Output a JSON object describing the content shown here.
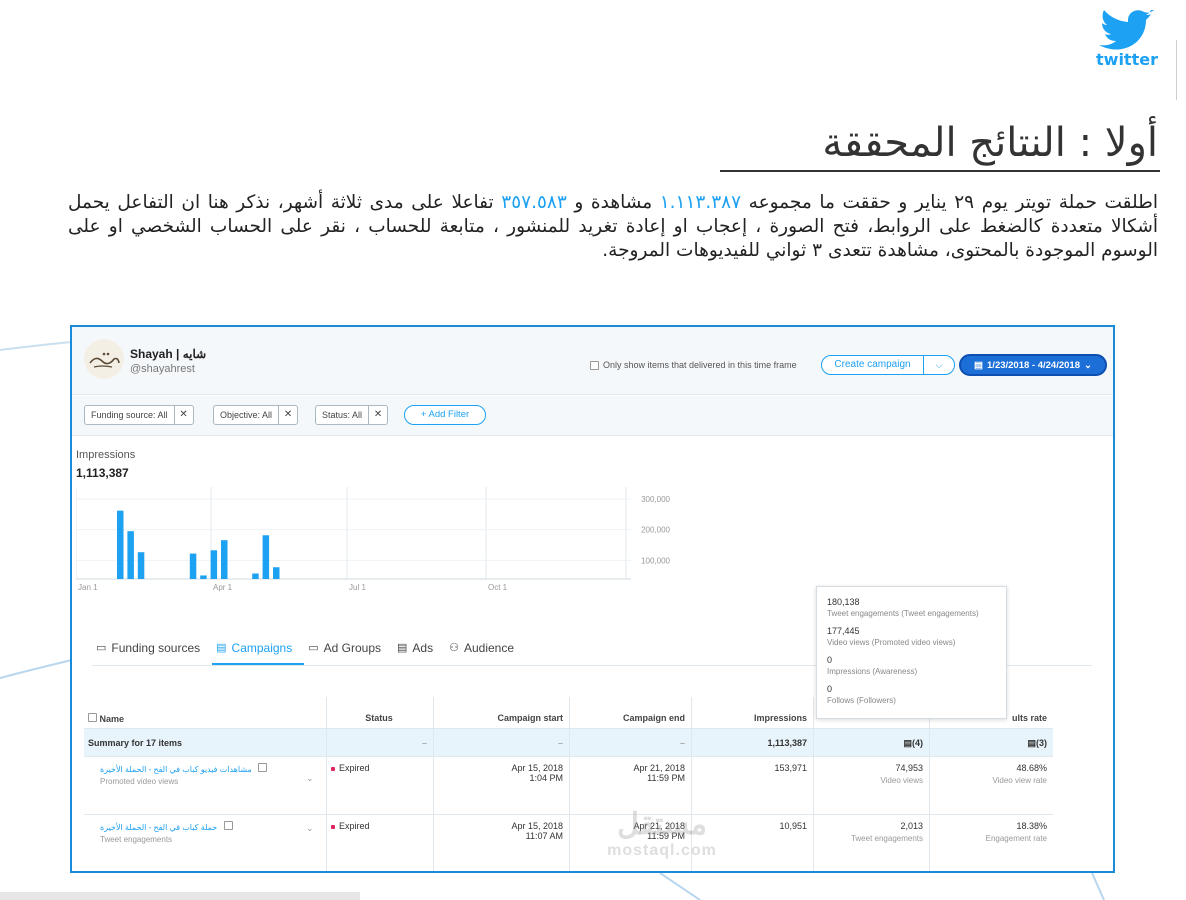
{
  "brand": {
    "logo_word": "twitter"
  },
  "heading": "أولا : النتائج المحققة",
  "paragraph": {
    "part1": "اطلقت حملة تويتر يوم ٢٩ يناير و حققت ما مجموعه ",
    "views_num": "١.١١٣.٣٨٧",
    "part2": " مشاهدة و ",
    "engage_num": "٣٥٧.٥٨٣",
    "part3": " تفاعلا على مدى ثلاثة أشهر، نذكر هنا ان التفاعل يحمل أشكالا متعددة كالضغط على الروابط، فتح الصورة ، إعجاب او إعادة تغريد للمنشور ، متابعة للحساب ، نقر على الحساب الشخصي او على الوسوم الموجودة بالمحتوى، مشاهدة تتعدى ٣ ثواني للفيديوهات المروجة."
  },
  "account": {
    "name": "Shayah | شايه",
    "handle": "@shayahrest"
  },
  "toolbar": {
    "only_show": "Only show items that delivered in this time frame",
    "create_campaign": "Create campaign",
    "date_range": "1/23/2018 - 4/24/2018"
  },
  "filters": [
    {
      "label": "Funding source: All"
    },
    {
      "label": "Objective: All"
    },
    {
      "label": "Status: All"
    }
  ],
  "add_filter": "+ Add Filter",
  "metric": {
    "label": "Impressions",
    "value": "1,113,387"
  },
  "chart_data": {
    "type": "bar",
    "ylabel": "",
    "yticks": [
      "100,000",
      "200,000",
      "300,000"
    ],
    "ylim": [
      0,
      300000
    ],
    "xticks": [
      "Jan 1",
      "Apr 1",
      "Jul 1",
      "Oct 1"
    ],
    "series": [
      {
        "values": [
          250000,
          175000,
          98000,
          0,
          0,
          0,
          0,
          93000,
          13000,
          105000,
          142000,
          0,
          0,
          20000,
          160000,
          43000
        ]
      }
    ],
    "color": "#1da1f2",
    "grid": true
  },
  "tabs": [
    {
      "label": "Funding sources",
      "icon": "card-icon"
    },
    {
      "label": "Campaigns",
      "icon": "list-icon"
    },
    {
      "label": "Ad Groups",
      "icon": "folder-icon"
    },
    {
      "label": "Ads",
      "icon": "ad-icon"
    },
    {
      "label": "Audience",
      "icon": "people-icon"
    }
  ],
  "table": {
    "headers": [
      "Name",
      "Status",
      "Campaign start",
      "Campaign end",
      "Impressions",
      "ults rate"
    ],
    "summary": {
      "label": "Summary for 17 items",
      "status": "–",
      "start": "–",
      "end": "–",
      "impressions": "1,113,387",
      "results": "(4)",
      "rate": "(3)"
    },
    "rows": [
      {
        "name": "مشاهدات فيديو كباب في الفح - الحملة الأخيرة",
        "objective": "Promoted video views",
        "status": "Expired",
        "start_date": "Apr 15, 2018",
        "start_time": "1:04 PM",
        "end_date": "Apr 21, 2018",
        "end_time": "11:59 PM",
        "impressions": "153,971",
        "results": "74,953",
        "results_label": "Video views",
        "rate": "48.68%",
        "rate_label": "Video view rate"
      },
      {
        "name": "حملة كباب في الفح - الحملة الأخيرة",
        "objective": "Tweet engagements",
        "status": "Expired",
        "start_date": "Apr 15, 2018",
        "start_time": "11:07 AM",
        "end_date": "Apr 21, 2018",
        "end_time": "11:59 PM",
        "impressions": "10,951",
        "results": "2,013",
        "results_label": "Tweet engagements",
        "rate": "18.38%",
        "rate_label": "Engagement rate"
      }
    ]
  },
  "tooltip": [
    {
      "value": "180,138",
      "desc": "Tweet engagements (Tweet engagements)"
    },
    {
      "value": "177,445",
      "desc": "Video views (Promoted video views)"
    },
    {
      "value": "0",
      "desc": "Impressions (Awareness)"
    },
    {
      "value": "0",
      "desc": "Follows (Followers)"
    }
  ],
  "watermark": {
    "ar": "مستقل",
    "en": "mostaql.com"
  },
  "colors": {
    "accent": "#1da1f2",
    "border": "#1a8bd8",
    "expired": "#e0245e"
  }
}
